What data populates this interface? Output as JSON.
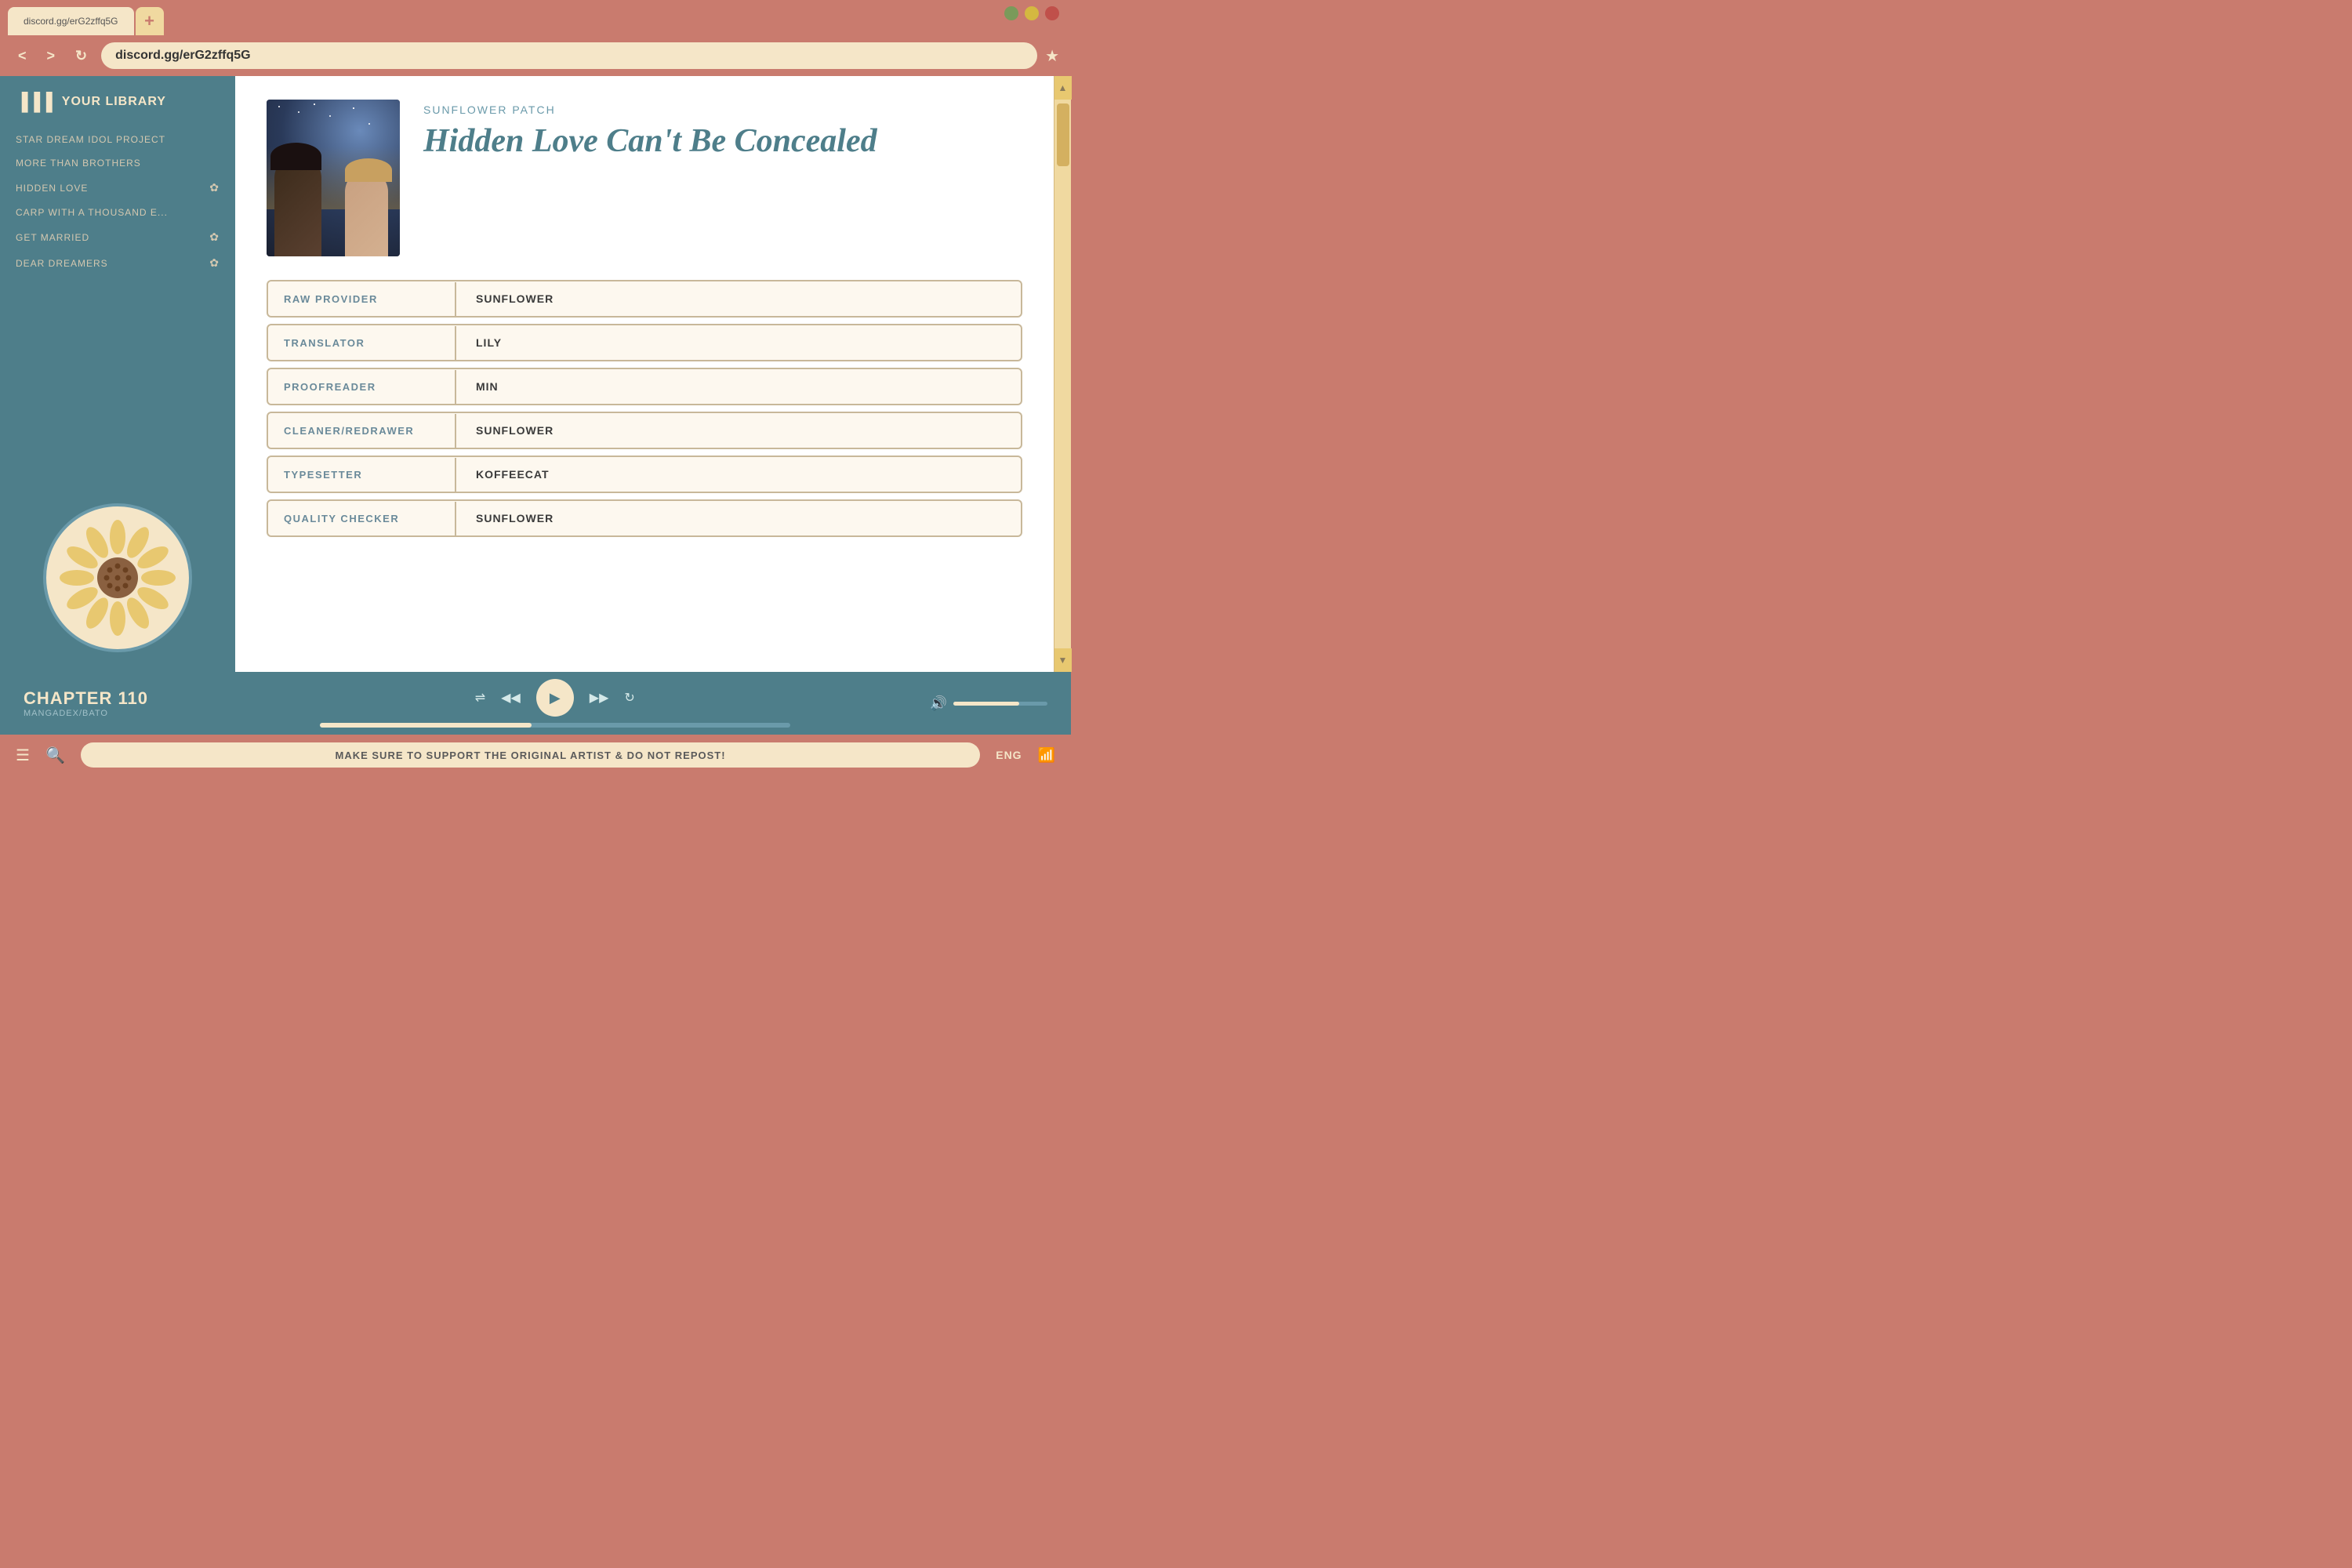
{
  "browser": {
    "tab_label": "discord.gg/erG2zffq5G",
    "address": "discord.gg/erG2zffq5G",
    "tab_add_icon": "+",
    "back_icon": "<",
    "forward_icon": ">",
    "refresh_icon": "↻",
    "bookmark_icon": "★"
  },
  "sidebar": {
    "title": "YOUR LIBRARY",
    "items": [
      {
        "label": "STAR DREAM IDOL PROJECT",
        "heart": false
      },
      {
        "label": "MORE THAN BROTHERS",
        "heart": false
      },
      {
        "label": "HIDDEN LOVE",
        "heart": true
      },
      {
        "label": "CARP WITH A THOUSAND E...",
        "heart": false
      },
      {
        "label": "GET MARRIED",
        "heart": true
      },
      {
        "label": "DEAR DREAMERS",
        "heart": true
      }
    ]
  },
  "manga": {
    "group": "SUNFLOWER PATCH",
    "title": "Hidden Love Can't Be Concealed",
    "credits": [
      {
        "label": "RAW PROVIDER",
        "value": "SUNFLOWER"
      },
      {
        "label": "TRANSLATOR",
        "value": "LILY"
      },
      {
        "label": "PROOFREADER",
        "value": "MIN"
      },
      {
        "label": "CLEANER/REDRAWER",
        "value": "SUNFLOWER"
      },
      {
        "label": "TYPESETTER",
        "value": "KOFFEECAT"
      },
      {
        "label": "QUALITY CHECKER",
        "value": "SUNFLOWER"
      }
    ]
  },
  "player": {
    "chapter": "CHAPTER 110",
    "source": "MANGADEX/BATO",
    "progress": 45
  },
  "status_bar": {
    "message": "MAKE SURE TO SUPPORT THE ORIGINAL ARTIST & DO NOT REPOST!",
    "language": "ENG"
  }
}
